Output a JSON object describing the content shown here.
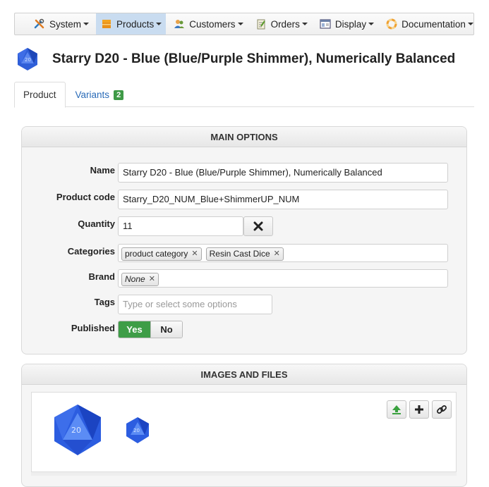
{
  "menu": {
    "items": [
      {
        "label": "System",
        "icon": "tools-icon"
      },
      {
        "label": "Products",
        "icon": "box-icon",
        "active": true
      },
      {
        "label": "Customers",
        "icon": "users-icon"
      },
      {
        "label": "Orders",
        "icon": "clipboard-icon"
      },
      {
        "label": "Display",
        "icon": "window-icon"
      },
      {
        "label": "Documentation",
        "icon": "lifebuoy-icon"
      }
    ]
  },
  "page": {
    "title": "Starry D20 - Blue (Blue/Purple Shimmer), Numerically Balanced"
  },
  "tabs": {
    "product": "Product",
    "variants": "Variants",
    "variants_count": "2"
  },
  "main_options": {
    "heading": "MAIN OPTIONS",
    "name_label": "Name",
    "name_value": "Starry D20 - Blue (Blue/Purple Shimmer), Numerically Balanced",
    "code_label": "Product code",
    "code_value": "Starry_D20_NUM_Blue+ShimmerUP_NUM",
    "quantity_label": "Quantity",
    "quantity_value": "11",
    "categories_label": "Categories",
    "categories": [
      "product category",
      "Resin Cast Dice"
    ],
    "brand_label": "Brand",
    "brand_value": "None",
    "tags_label": "Tags",
    "tags_placeholder": "Type or select some options",
    "published_label": "Published",
    "published_yes": "Yes",
    "published_no": "No",
    "published": true
  },
  "images": {
    "heading": "IMAGES AND FILES"
  },
  "colors": {
    "accent_blue": "#2a6bb8",
    "green": "#3e9d47",
    "active_menu": "#c9dcf0"
  }
}
